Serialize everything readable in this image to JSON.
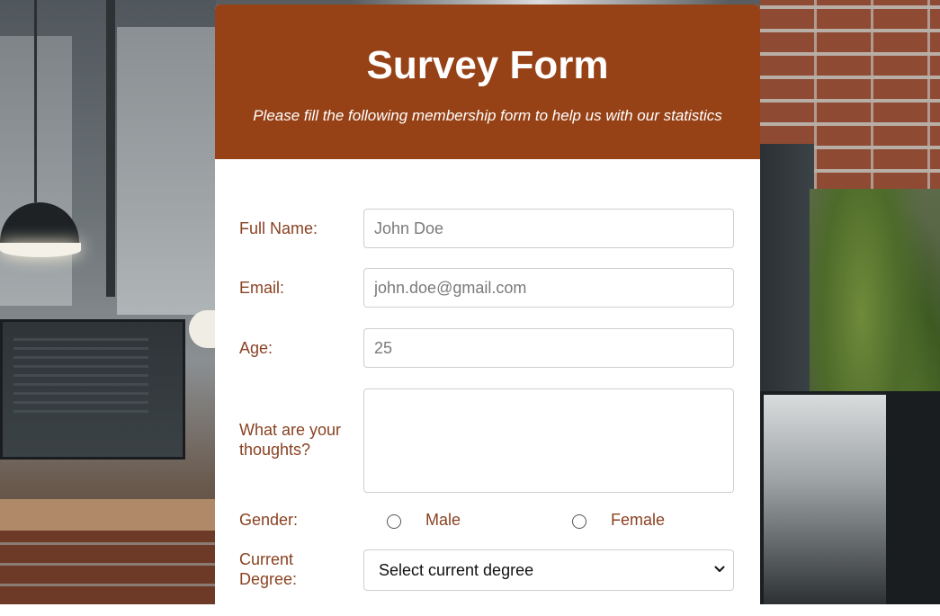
{
  "form": {
    "title": "Survey Form",
    "subtitle": "Please fill the following membership form to help us with our statistics",
    "fields": {
      "full_name": {
        "label": "Full Name:",
        "placeholder": "John Doe"
      },
      "email": {
        "label": "Email:",
        "placeholder": "john.doe@gmail.com"
      },
      "age": {
        "label": "Age:",
        "placeholder": "25"
      },
      "thoughts": {
        "label": "What are your thoughts?",
        "label_line1": "What are your",
        "label_line2": "thoughts?",
        "placeholder": ""
      },
      "gender": {
        "label": "Gender:",
        "options": [
          "Male",
          "Female"
        ],
        "selected": null
      },
      "degree": {
        "label": "Current Degree:",
        "label_line1": "Current",
        "label_line2": "Degree:",
        "selected_text": "Select current degree"
      }
    }
  },
  "colors": {
    "header_bg": "#974216",
    "label_text": "#8a4222"
  },
  "icons": {
    "select_arrow": "chevron-down-icon"
  }
}
